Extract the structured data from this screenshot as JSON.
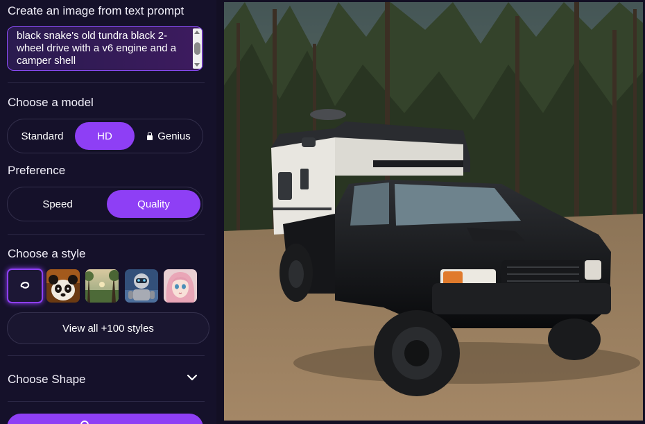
{
  "prompt_section": {
    "title": "Create an image from text prompt",
    "prompt_text": "black snake's old tundra black 2-wheel drive with a v6 engine and a camper shell"
  },
  "model_section": {
    "title": "Choose a model",
    "options": [
      "Standard",
      "HD",
      "Genius"
    ],
    "selected": "HD"
  },
  "preference_section": {
    "title": "Preference",
    "options": [
      "Speed",
      "Quality"
    ],
    "selected": "Quality"
  },
  "style_section": {
    "title": "Choose a style",
    "view_all_label": "View all +100 styles"
  },
  "shape_section": {
    "title": "Choose Shape"
  },
  "colors": {
    "accent": "#8e3ff5",
    "background": "#15112a"
  }
}
